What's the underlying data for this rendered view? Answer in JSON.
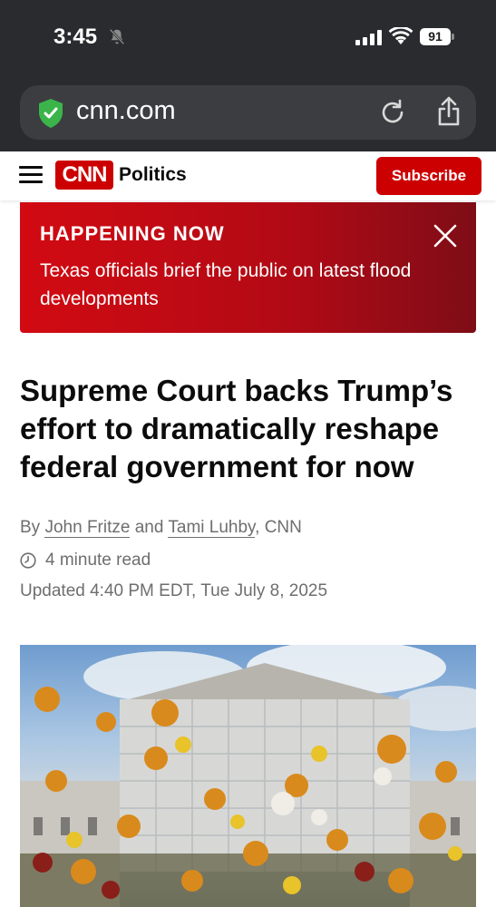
{
  "status_bar": {
    "time": "3:45",
    "battery": "91"
  },
  "browser": {
    "url": "cnn.com"
  },
  "site_header": {
    "logo": "CNN",
    "section": "Politics",
    "subscribe_label": "Subscribe"
  },
  "breaking": {
    "label": "HAPPENING NOW",
    "text": "Texas officials brief the public on latest flood developments"
  },
  "article": {
    "headline": "Supreme Court backs Trump’s effort to dramatically reshape federal government for now",
    "by_prefix": "By",
    "author1": "John Fritze",
    "and": "and",
    "author2": "Tami Luhby",
    "outlet": ", CNN",
    "read_time": "4 minute read",
    "updated": "Updated 4:40 PM EDT, Tue July 8, 2025"
  },
  "colors": {
    "cnn_red": "#cc0000",
    "chrome_dark": "#2a2b2e"
  },
  "icons": [
    "bell-slash-icon",
    "signal-icon",
    "wifi-icon",
    "shield-check-icon",
    "reload-icon",
    "share-icon",
    "menu-icon",
    "close-icon",
    "clock-icon"
  ]
}
